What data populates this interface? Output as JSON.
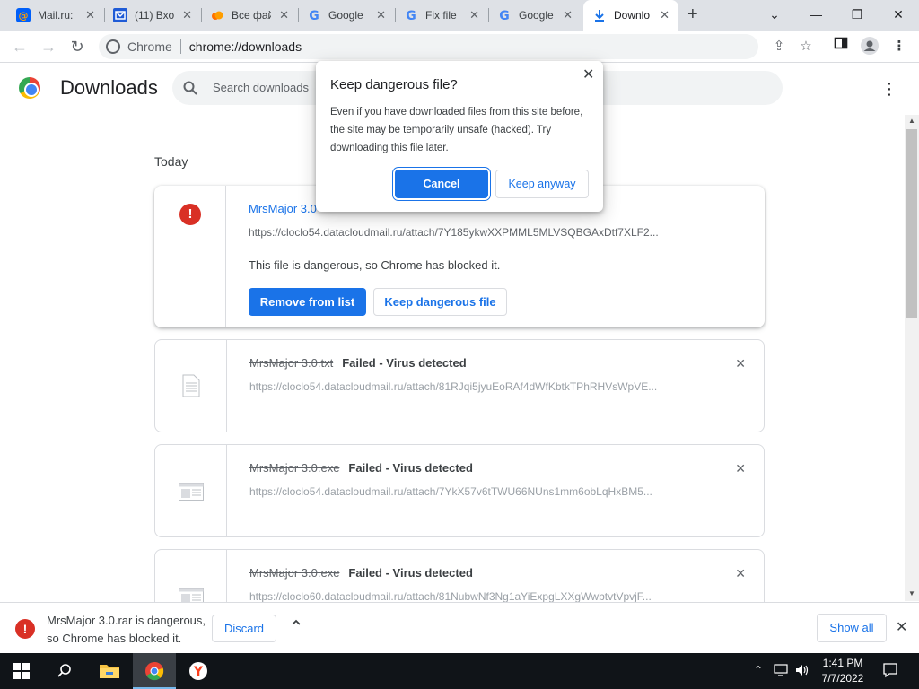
{
  "tabs": [
    {
      "title": "Mail.ru:",
      "icon": "mail-ru-icon"
    },
    {
      "title": "(11) Вхо",
      "icon": "inbox-mail-icon"
    },
    {
      "title": "Все фай",
      "icon": "cloud-icon"
    },
    {
      "title": "Google",
      "icon": "google-icon"
    },
    {
      "title": "Fix file",
      "icon": "google-icon"
    },
    {
      "title": "Google",
      "icon": "google-icon"
    },
    {
      "title": "Downlo",
      "icon": "download-icon",
      "active": true
    }
  ],
  "toolbar": {
    "chip": "Chrome",
    "url": "chrome://downloads"
  },
  "page": {
    "title": "Downloads",
    "search_placeholder": "Search downloads",
    "section": "Today"
  },
  "downloads": [
    {
      "name": "MrsMajor 3.0",
      "url": "https://cloclo54.datacloudmail.ru/attach/7Y185ykwXXPMML5MLVSQBGAxDtf7XLF2...",
      "message": "This file is dangerous, so Chrome has blocked it.",
      "remove_label": "Remove from list",
      "keep_label": "Keep dangerous file"
    },
    {
      "name": "MrsMajor 3.0.txt",
      "status": "Failed - Virus detected",
      "url": "https://cloclo54.datacloudmail.ru/attach/81RJqi5jyuEoRAf4dWfKbtkTPhRHVsWpVE..."
    },
    {
      "name": "MrsMajor 3.0.exe",
      "status": "Failed - Virus detected",
      "url": "https://cloclo54.datacloudmail.ru/attach/7YkX57v6tTWU66NUns1mm6obLqHxBM5..."
    },
    {
      "name": "MrsMajor 3.0.exe",
      "status": "Failed - Virus detected",
      "url": "https://cloclo60.datacloudmail.ru/attach/81NubwNf3Ng1aYiExpgLXXgWwbtvtVpvjF..."
    }
  ],
  "dialog": {
    "title": "Keep dangerous file?",
    "body": "Even if you have downloaded files from this site before, the site may be temporarily unsafe (hacked). Try downloading this file later.",
    "cancel": "Cancel",
    "keep": "Keep anyway"
  },
  "shelf": {
    "message": "MrsMajor 3.0.rar is dangerous, so Chrome has blocked it.",
    "discard": "Discard",
    "show_all": "Show all"
  },
  "taskbar": {
    "time": "1:41 PM",
    "date": "7/7/2022"
  },
  "colors": {
    "accent": "#1a73e8",
    "danger": "#d93025",
    "tabstrip": "#dee1e6"
  }
}
